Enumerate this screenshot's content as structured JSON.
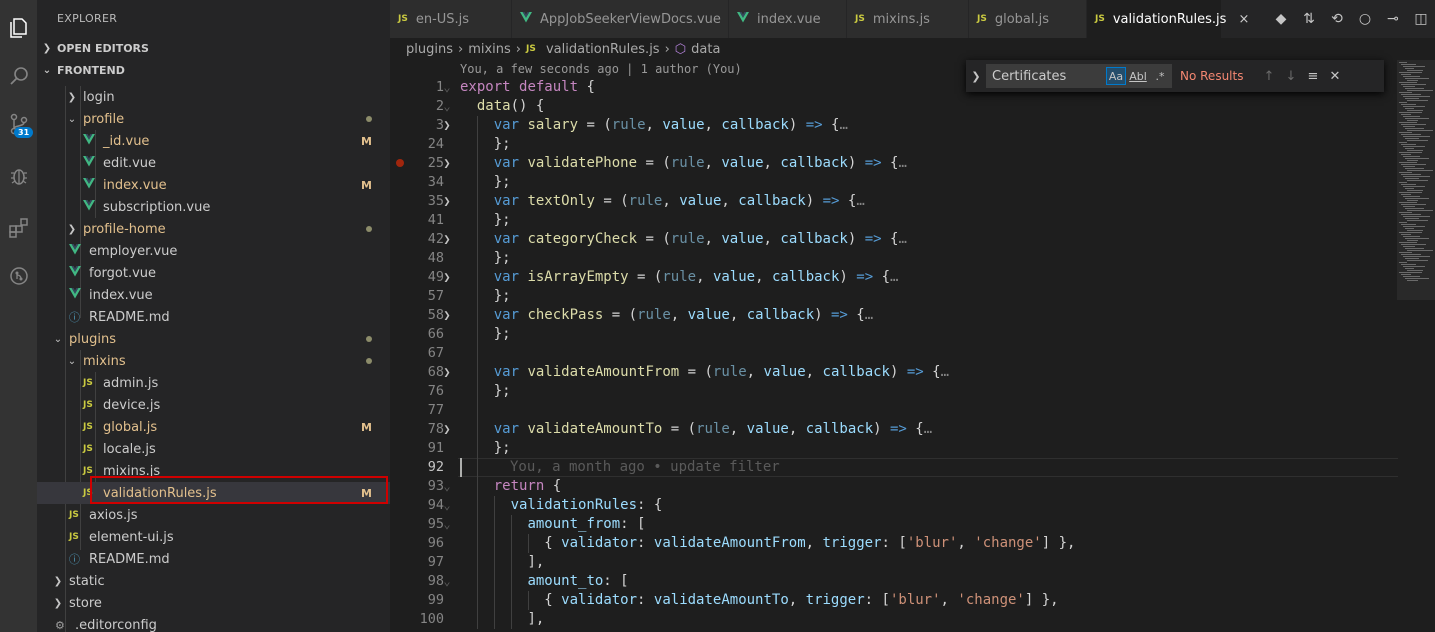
{
  "explorer": {
    "title": "EXPLORER",
    "sections": {
      "open_editors": "OPEN EDITORS",
      "frontend": "FRONTEND"
    },
    "tree": [
      {
        "label": "login",
        "type": "folder",
        "collapsed": true,
        "depth": 2,
        "status": ""
      },
      {
        "label": "profile",
        "type": "folder",
        "collapsed": false,
        "depth": 2,
        "status": "dot"
      },
      {
        "label": "_id.vue",
        "type": "vue",
        "depth": 3,
        "status": "M"
      },
      {
        "label": "edit.vue",
        "type": "vue",
        "depth": 3,
        "status": ""
      },
      {
        "label": "index.vue",
        "type": "vue",
        "depth": 3,
        "status": "M"
      },
      {
        "label": "subscription.vue",
        "type": "vue",
        "depth": 3,
        "status": ""
      },
      {
        "label": "profile-home",
        "type": "folder",
        "collapsed": true,
        "depth": 2,
        "status": "dot"
      },
      {
        "label": "employer.vue",
        "type": "vue",
        "depth": 2,
        "status": ""
      },
      {
        "label": "forgot.vue",
        "type": "vue",
        "depth": 2,
        "status": ""
      },
      {
        "label": "index.vue",
        "type": "vue",
        "depth": 2,
        "status": ""
      },
      {
        "label": "README.md",
        "type": "info",
        "depth": 2,
        "status": ""
      },
      {
        "label": "plugins",
        "type": "folder",
        "collapsed": false,
        "depth": 1,
        "status": "dot"
      },
      {
        "label": "mixins",
        "type": "folder",
        "collapsed": false,
        "depth": 2,
        "status": "dot"
      },
      {
        "label": "admin.js",
        "type": "js",
        "depth": 3,
        "status": ""
      },
      {
        "label": "device.js",
        "type": "js",
        "depth": 3,
        "status": ""
      },
      {
        "label": "global.js",
        "type": "js",
        "depth": 3,
        "status": "M",
        "modified": true
      },
      {
        "label": "locale.js",
        "type": "js",
        "depth": 3,
        "status": ""
      },
      {
        "label": "mixins.js",
        "type": "js",
        "depth": 3,
        "status": ""
      },
      {
        "label": "validationRules.js",
        "type": "js",
        "depth": 3,
        "status": "M",
        "selected": true
      },
      {
        "label": "axios.js",
        "type": "js",
        "depth": 2,
        "status": ""
      },
      {
        "label": "element-ui.js",
        "type": "js",
        "depth": 2,
        "status": ""
      },
      {
        "label": "README.md",
        "type": "info",
        "depth": 2,
        "status": ""
      },
      {
        "label": "static",
        "type": "folder",
        "collapsed": true,
        "depth": 1,
        "status": ""
      },
      {
        "label": "store",
        "type": "folder",
        "collapsed": true,
        "depth": 1,
        "status": ""
      },
      {
        "label": ".editorconfig",
        "type": "settings",
        "depth": 1,
        "status": ""
      }
    ]
  },
  "activity_badge": "31",
  "tabs": [
    {
      "label": "en-US.js",
      "type": "js"
    },
    {
      "label": "AppJobSeekerViewDocs.vue",
      "type": "vue"
    },
    {
      "label": "index.vue",
      "type": "vue"
    },
    {
      "label": "mixins.js",
      "type": "js"
    },
    {
      "label": "global.js",
      "type": "js"
    },
    {
      "label": "validationRules.js",
      "type": "js",
      "active": true
    }
  ],
  "tab_close": "×",
  "breadcrumb": [
    "plugins",
    "mixins",
    "validationRules.js",
    "data"
  ],
  "codelens": "You, a few seconds ago | 1 author (You)",
  "blame": "You, a month ago • update filter",
  "find": {
    "value": "Certificates",
    "case_label": "Aa",
    "word_label": "Abl",
    "regex_label": ".*",
    "result": "No Results"
  },
  "code": [
    {
      "n": "1",
      "t": "export default {"
    },
    {
      "n": "2",
      "t": "  data() {"
    },
    {
      "n": "3",
      "t": "    var salary = (rule, value, callback) => {…"
    },
    {
      "n": "24",
      "t": "    };"
    },
    {
      "n": "25",
      "t": "    var validatePhone = (rule, value, callback) => {…"
    },
    {
      "n": "34",
      "t": "    };"
    },
    {
      "n": "35",
      "t": "    var textOnly = (rule, value, callback) => {…"
    },
    {
      "n": "41",
      "t": "    };"
    },
    {
      "n": "42",
      "t": "    var categoryCheck = (rule, value, callback) => {…"
    },
    {
      "n": "48",
      "t": "    };"
    },
    {
      "n": "49",
      "t": "    var isArrayEmpty = (rule, value, callback) => {…"
    },
    {
      "n": "57",
      "t": "    };"
    },
    {
      "n": "58",
      "t": "    var checkPass = (rule, value, callback) => {…"
    },
    {
      "n": "66",
      "t": "    };"
    },
    {
      "n": "67",
      "t": ""
    },
    {
      "n": "68",
      "t": "    var validateAmountFrom = (rule, value, callback) => {…"
    },
    {
      "n": "76",
      "t": "    };"
    },
    {
      "n": "77",
      "t": ""
    },
    {
      "n": "78",
      "t": "    var validateAmountTo = (rule, value, callback) => {…"
    },
    {
      "n": "91",
      "t": "    };"
    },
    {
      "n": "92",
      "t": ""
    },
    {
      "n": "93",
      "t": "    return {"
    },
    {
      "n": "94",
      "t": "      validationRules: {"
    },
    {
      "n": "95",
      "t": "        amount_from: ["
    },
    {
      "n": "96",
      "t": "          { validator: validateAmountFrom, trigger: ['blur', 'change'] },"
    },
    {
      "n": "97",
      "t": "        ],"
    },
    {
      "n": "98",
      "t": "        amount_to: ["
    },
    {
      "n": "99",
      "t": "          { validator: validateAmountTo, trigger: ['blur', 'change'] },"
    },
    {
      "n": "100",
      "t": "        ],"
    }
  ]
}
